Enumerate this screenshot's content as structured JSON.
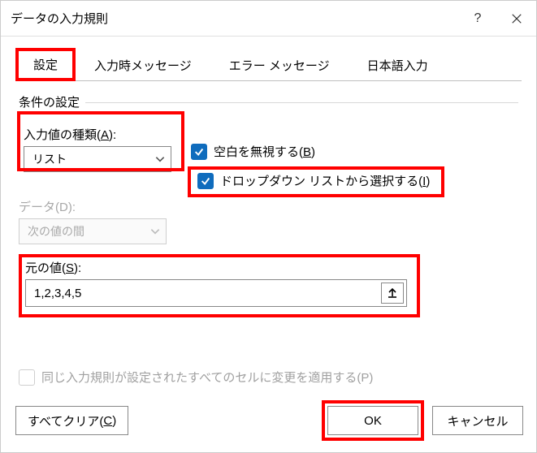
{
  "titlebar": {
    "title": "データの入力規則",
    "help": "?",
    "close": "×"
  },
  "tabs": {
    "settings": "設定",
    "input_msg": "入力時メッセージ",
    "error_msg": "エラー メッセージ",
    "ime": "日本語入力"
  },
  "group_label": "条件の設定",
  "allow": {
    "label_plain": "入力値の種類(",
    "label_key": "A",
    "label_end": "):",
    "value": "リスト"
  },
  "data_field": {
    "label_plain": "データ(",
    "label_key": "D",
    "label_end": "):",
    "value": "次の値の間"
  },
  "ignore_blank": {
    "label_pre": "空白を無視する(",
    "label_key": "B",
    "label_post": ")"
  },
  "in_cell_dropdown": {
    "label_pre": "ドロップダウン リストから選択する(",
    "label_key": "I",
    "label_post": ")"
  },
  "source": {
    "label_pre": "元の値(",
    "label_key": "S",
    "label_post": "):",
    "value": "1,2,3,4,5"
  },
  "apply_all": {
    "label_pre": "同じ入力規則が設定されたすべてのセルに変更を適用する(",
    "label_key": "P",
    "label_post": ")"
  },
  "buttons": {
    "clear_pre": "すべてクリア(",
    "clear_key": "C",
    "clear_post": ")",
    "ok": "OK",
    "cancel": "キャンセル"
  }
}
